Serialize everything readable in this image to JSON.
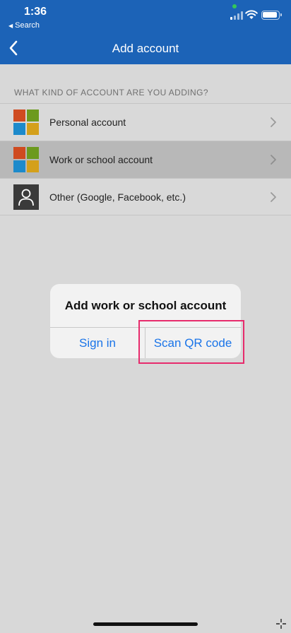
{
  "status_bar": {
    "time": "1:36",
    "back_app": "Search"
  },
  "nav": {
    "title": "Add account",
    "back_icon": "chevron-left-icon"
  },
  "section": {
    "header": "WHAT KIND OF ACCOUNT ARE YOU ADDING?"
  },
  "accounts": [
    {
      "label": "Personal account",
      "icon": "microsoft-logo-icon"
    },
    {
      "label": "Work or school account",
      "icon": "microsoft-logo-icon",
      "selected": true
    },
    {
      "label": "Other (Google, Facebook, etc.)",
      "icon": "person-icon"
    }
  ],
  "dialog": {
    "title": "Add work or school account",
    "sign_in": "Sign in",
    "scan_qr": "Scan QR code"
  },
  "colors": {
    "header_bg": "#1c63b7",
    "accent": "#1a74e8",
    "highlight": "#e72b6c"
  }
}
